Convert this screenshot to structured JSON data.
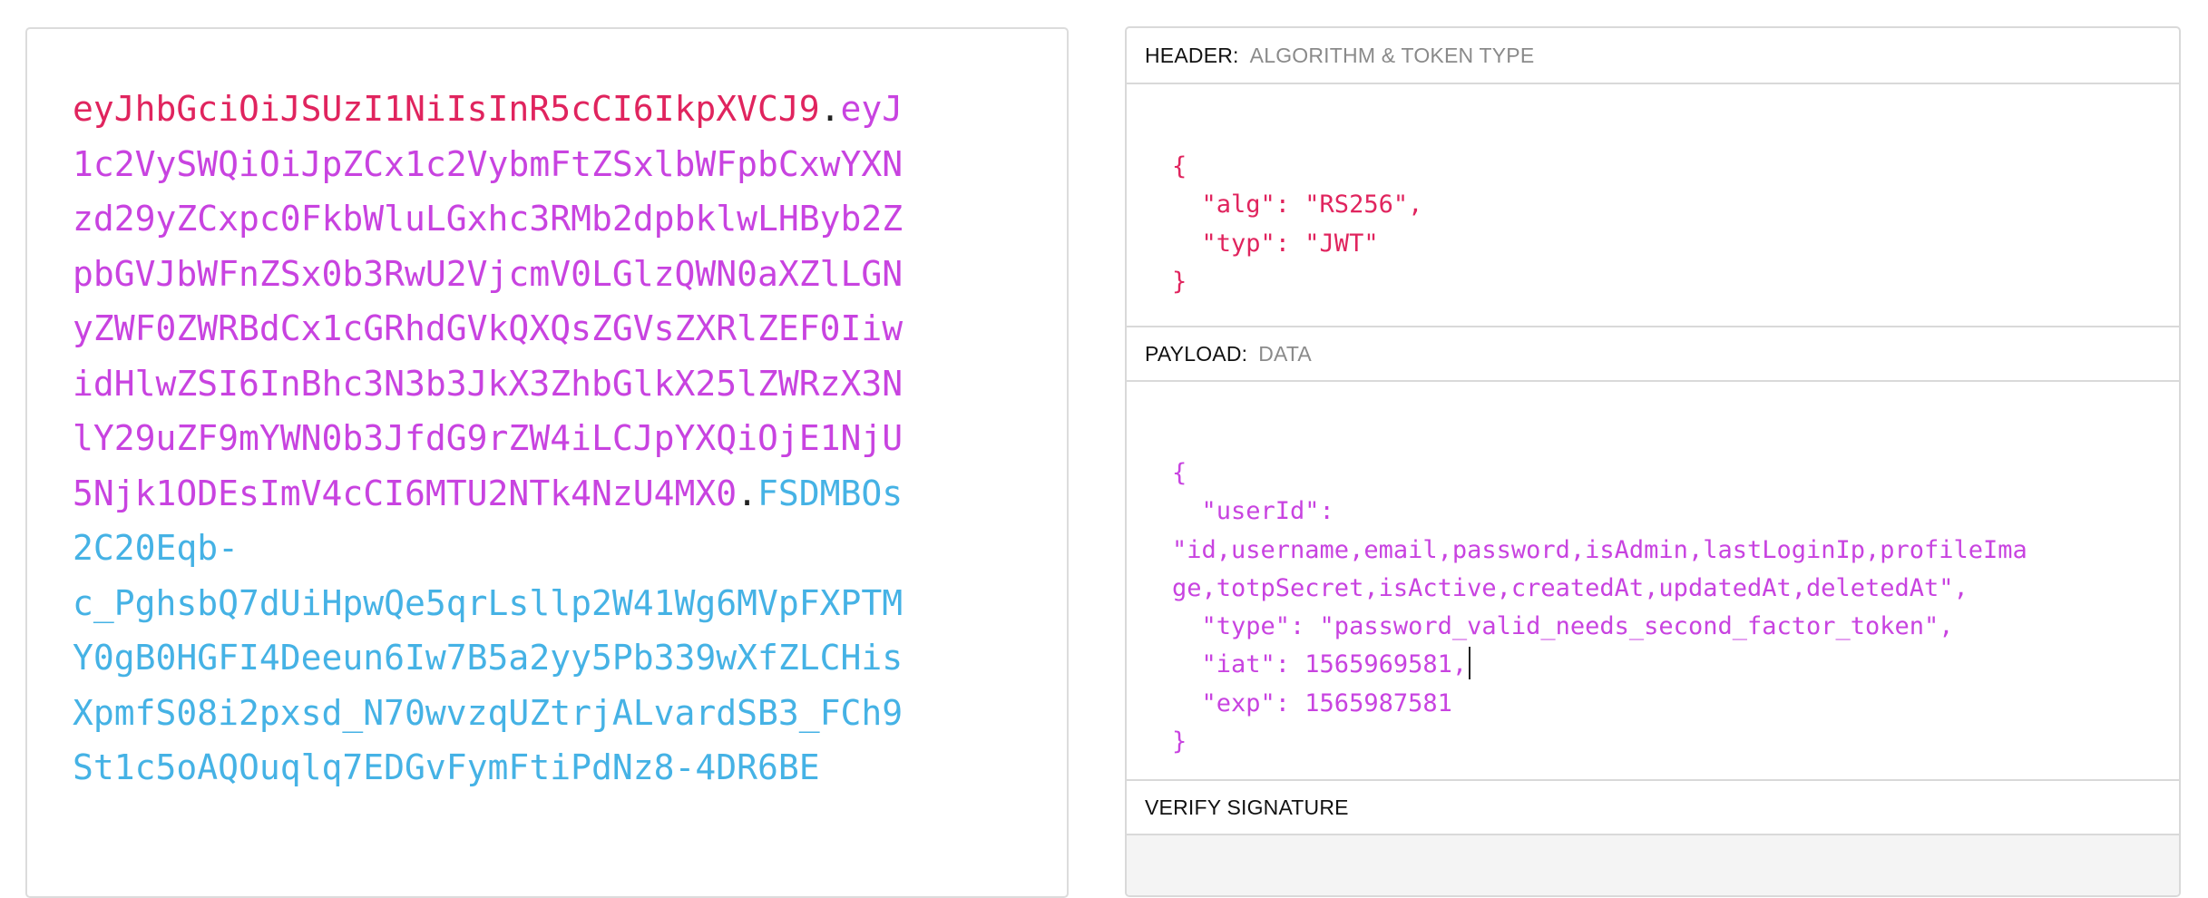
{
  "encoded": {
    "header_lines": [
      "eyJhbGciOiJSUzI1NiIsInR5cCI6IkpXVCJ9"
    ],
    "payload_first": "eyJ",
    "payload_lines": [
      "1c2VySWQiOiJpZCx1c2VybmFtZSxlbWFpbCxwYXN",
      "zd29yZCxpc0FkbWluLGxhc3RMb2dpbklwLHByb2Z",
      "pbGVJbWFnZSx0b3RwU2VjcmV0LGlzQWN0aXZlLGN",
      "yZWF0ZWRBdCx1cGRhdGVkQXQsZGVsZXRlZEF0Iiw",
      "idHlwZSI6InBhc3N3b3JkX3ZhbGlkX25lZWRzX3N",
      "lY29uZF9mYWN0b3JfdG9rZW4iLCJpYXQiOjE1NjU",
      "5Njk1ODEsImV4cCI6MTU2NTk4NzU4MX0"
    ],
    "signature_first": "FSDMBOs",
    "signature_lines": [
      "2C20Eqb-",
      "c_PghsbQ7dUiHpwQe5qrLsllp2W41Wg6MVpFXPTM",
      "Y0gB0HGFI4Deeun6Iw7B5a2yy5Pb339wXfZLCHis",
      "XpmfS08i2pxsd_N70wvzqUZtrjALvardSB3_FCh9",
      "St1c5oAQOuqlq7EDGvFymFtiPdNz8-4DR6BE"
    ],
    "dot": "."
  },
  "decoded": {
    "header_section": {
      "title": "HEADER:",
      "subtitle": "ALGORITHM & TOKEN TYPE",
      "json": "{\n  \"alg\": \"RS256\",\n  \"typ\": \"JWT\"\n}"
    },
    "payload_section": {
      "title": "PAYLOAD:",
      "subtitle": "DATA",
      "json_before_cursor": "{\n  \"userId\":\n\"id,username,email,password,isAdmin,lastLoginIp,profileIma\nge,totpSecret,isActive,createdAt,updatedAt,deletedAt\",\n  \"type\": \"password_valid_needs_second_factor_token\",\n  \"iat\": 1565969581,",
      "json_after_cursor": "\n  \"exp\": 1565987581\n}"
    },
    "verify_section": {
      "title": "VERIFY SIGNATURE"
    }
  },
  "colors": {
    "header": "#e0245e",
    "payload": "#c843e0",
    "signature": "#45b2e5",
    "border": "#d9d9d9",
    "verify_bg": "#f4f4f4"
  }
}
